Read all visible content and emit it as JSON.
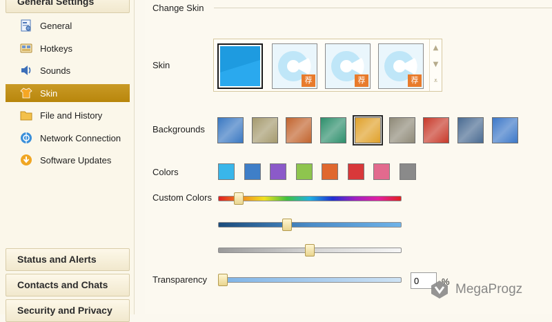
{
  "sidebar": {
    "top_group": "General Settings",
    "items": [
      {
        "label": "General",
        "icon": "settings-page-icon"
      },
      {
        "label": "Hotkeys",
        "icon": "keyboard-icon"
      },
      {
        "label": "Sounds",
        "icon": "speaker-icon"
      },
      {
        "label": "Skin",
        "icon": "shirt-icon",
        "active": true
      },
      {
        "label": "File and History",
        "icon": "folder-icon"
      },
      {
        "label": "Network Connection",
        "icon": "network-icon"
      },
      {
        "label": "Software Updates",
        "icon": "update-icon"
      }
    ],
    "bottom_groups": [
      "Status and Alerts",
      "Contacts and Chats",
      "Security and Privacy"
    ]
  },
  "main": {
    "section_title": "Change Skin",
    "skin_label": "Skin",
    "skin_badge": "荐",
    "backgrounds_label": "Backgrounds",
    "colors_label": "Colors",
    "custom_colors_label": "Custom Colors",
    "transparency_label": "Transparency",
    "transparency_value": "0",
    "transparency_unit": "%"
  },
  "skins": [
    {
      "kind": "blue",
      "selected": true
    },
    {
      "kind": "disc",
      "badge": true
    },
    {
      "kind": "disc",
      "badge": true
    },
    {
      "kind": "disc",
      "badge": true
    }
  ],
  "backgrounds": [
    {
      "color": "#3a78c2",
      "selected": false
    },
    {
      "color": "#a59a6e",
      "selected": false
    },
    {
      "color": "#c2642e",
      "selected": false
    },
    {
      "color": "#2e8f6c",
      "selected": false
    },
    {
      "color": "#e0a12a",
      "selected": true
    },
    {
      "color": "#8f8a78",
      "selected": false
    },
    {
      "color": "#c83a2a",
      "selected": false
    },
    {
      "color": "#4a6b92",
      "selected": false
    },
    {
      "color": "#3d78c8",
      "selected": false
    }
  ],
  "colors": [
    "#39b6ea",
    "#3f7fc8",
    "#8b5ac9",
    "#8ec54e",
    "#e0682e",
    "#d8383a",
    "#e26a8e",
    "#8a8a8a"
  ],
  "custom_colors": {
    "hue_fraction": 0.09,
    "saturation_fraction": 0.37,
    "lightness_fraction": 0.5
  },
  "transparency_fraction": 0.0,
  "watermark": "MegaProgz"
}
